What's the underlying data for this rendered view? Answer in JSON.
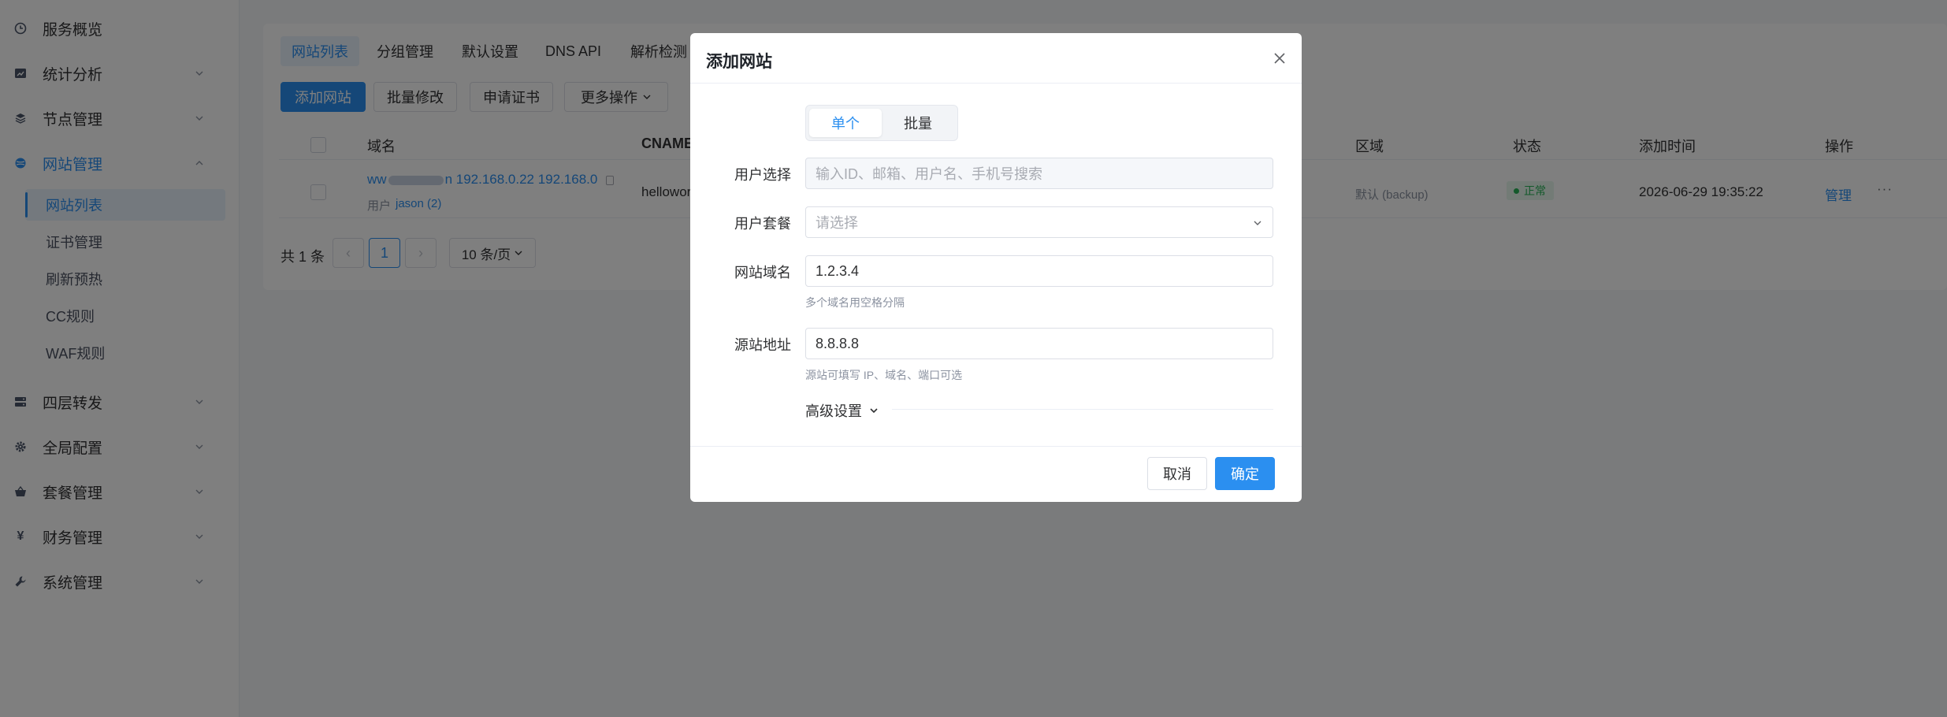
{
  "sidebar": {
    "groups": [
      {
        "label": "服务概览",
        "icon": "clock-icon"
      },
      {
        "label": "统计分析",
        "icon": "chart-icon"
      },
      {
        "label": "节点管理",
        "icon": "layers-icon"
      },
      {
        "label": "网站管理",
        "icon": "globe-icon"
      },
      {
        "label": "四层转发",
        "icon": "server-icon"
      },
      {
        "label": "全局配置",
        "icon": "gear-icon"
      },
      {
        "label": "套餐管理",
        "icon": "basket-icon"
      },
      {
        "label": "财务管理",
        "icon": "yen-icon"
      },
      {
        "label": "系统管理",
        "icon": "wrench-icon"
      }
    ],
    "sub_items": [
      "网站列表",
      "证书管理",
      "刷新预热",
      "CC规则",
      "WAF规则"
    ]
  },
  "tabs": [
    "网站列表",
    "分组管理",
    "默认设置",
    "DNS API",
    "解析检测"
  ],
  "toolbar": {
    "add": "添加网站",
    "batch_edit": "批量修改",
    "apply_cert": "申请证书",
    "more": "更多操作"
  },
  "table": {
    "headers": {
      "domain": "域名",
      "cname": "CNAME",
      "region": "区域",
      "status": "状态",
      "added": "添加时间",
      "action": "操作"
    },
    "row": {
      "domain_prefix": "ww",
      "domain_suffix": "n 192.168.0.22 192.168.0",
      "user_label": "用户",
      "user_value": "jason (2)",
      "cname": "hellowor",
      "region": "默认 (backup)",
      "status": "正常",
      "added": "2026-06-29 19:35:22",
      "action": "管理",
      "more": "···"
    }
  },
  "pager": {
    "total": "共 1 条",
    "prev": "‹",
    "current": "1",
    "next": "›",
    "page_size": "10 条/页"
  },
  "modal": {
    "title": "添加网站",
    "segments": [
      "单个",
      "批量"
    ],
    "fields": {
      "user_label": "用户选择",
      "user_placeholder": "输入ID、邮箱、用户名、手机号搜索",
      "plan_label": "用户套餐",
      "plan_placeholder": "请选择",
      "domain_label": "网站域名",
      "domain_value": "1.2.3.4",
      "domain_hint": "多个域名用空格分隔",
      "origin_label": "源站地址",
      "origin_value": "8.8.8.8",
      "origin_hint": "源站可填写 IP、域名、端口可选"
    },
    "advanced": "高级设置",
    "cancel": "取消",
    "ok": "确定"
  },
  "colors": {
    "accent": "#2b8ff0",
    "success": "#27b356",
    "overlay": "rgba(0,0,0,0.5)"
  }
}
